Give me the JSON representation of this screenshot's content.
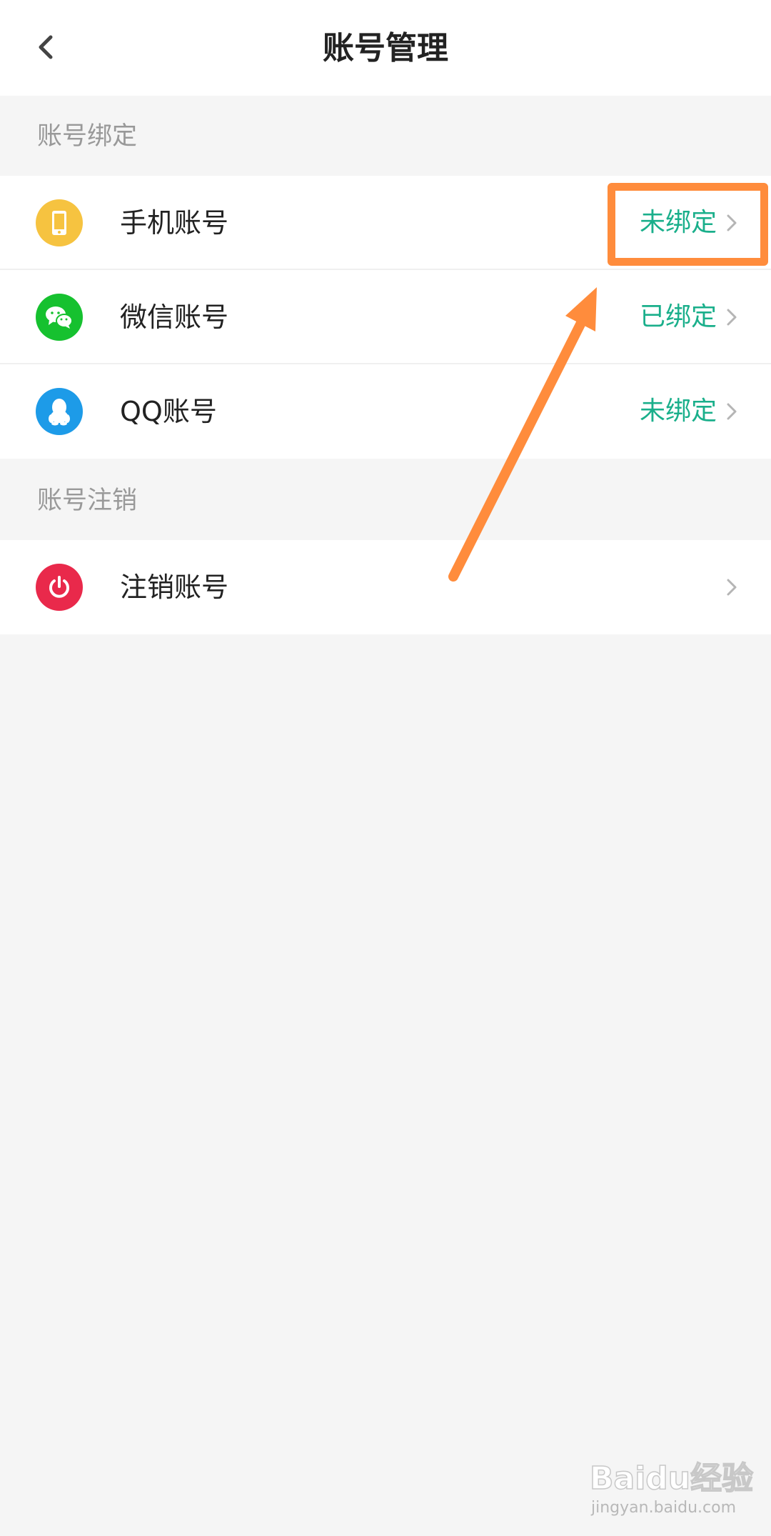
{
  "header": {
    "title": "账号管理",
    "back_icon": "chevron-left-icon"
  },
  "sections": [
    {
      "label": "账号绑定",
      "rows": [
        {
          "label": "手机账号",
          "status": "未绑定",
          "icon": "phone-icon",
          "icon_color": "#f6c340"
        },
        {
          "label": "微信账号",
          "status": "已绑定",
          "icon": "wechat-icon",
          "icon_color": "#16c12f"
        },
        {
          "label": "QQ账号",
          "status": "未绑定",
          "icon": "qq-icon",
          "icon_color": "#1d9be8"
        }
      ]
    },
    {
      "label": "账号注销",
      "rows": [
        {
          "label": "注销账号",
          "status": "",
          "icon": "power-icon",
          "icon_color": "#e9294b"
        }
      ]
    }
  ],
  "colors": {
    "status_text": "#1aaf8b",
    "annotation": "#ff8c3c",
    "background": "#f5f5f5"
  },
  "annotation": {
    "highlight": "手机账号 未绑定",
    "arrow": "arrow-up-right-icon"
  },
  "watermark": {
    "brand": "Baidu经验",
    "url": "jingyan.baidu.com"
  }
}
